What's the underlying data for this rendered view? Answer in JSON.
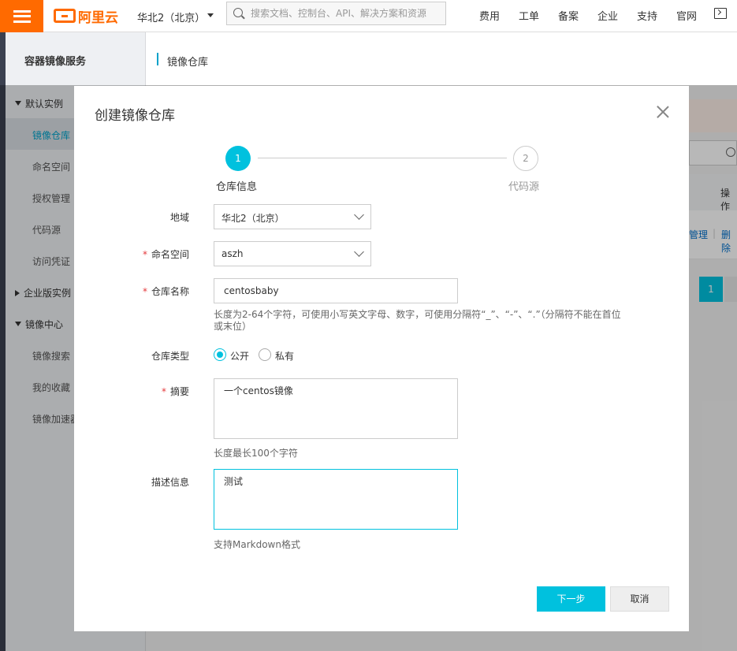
{
  "topbar": {
    "brand": "阿里云",
    "region": "华北2（北京）",
    "search_placeholder": "搜索文档、控制台、API、解决方案和资源",
    "nav": [
      "费用",
      "工单",
      "备案",
      "企业",
      "支持",
      "官网"
    ],
    "brand_color": "#ff6a00"
  },
  "service_title": "容器镜像服务",
  "breadcrumb": "镜像仓库",
  "sidebar": {
    "group_default": "默认实例",
    "items_default": [
      "镜像仓库",
      "命名空间",
      "授权管理",
      "代码源",
      "访问凭证"
    ],
    "group_enterprise": "企业版实例",
    "group_center": "镜像中心",
    "items_center": [
      "镜像搜索",
      "我的收藏",
      "镜像加速器"
    ]
  },
  "background": {
    "ops_header": "操作",
    "link_manage": "管理",
    "link_delete": "删除",
    "divider": "|",
    "page_current": "1"
  },
  "dialog": {
    "title": "创建镜像仓库",
    "steps": [
      {
        "num": "1",
        "label": "仓库信息"
      },
      {
        "num": "2",
        "label": "代码源"
      }
    ],
    "fields": {
      "region_label": "地域",
      "region_value": "华北2（北京）",
      "namespace_label": "命名空间",
      "namespace_value": "aszh",
      "repo_name_label": "仓库名称",
      "repo_name_value": "centosbaby",
      "repo_name_help": "长度为2-64个字符，可使用小写英文字母、数字，可使用分隔符“_”、“-”、“.”（分隔符不能在首位或末位）",
      "repo_type_label": "仓库类型",
      "type_public": "公开",
      "type_private": "私有",
      "summary_label": "摘要",
      "summary_value": "一个centos镜像",
      "summary_help": "长度最长100个字符",
      "desc_label": "描述信息",
      "desc_value": "测试",
      "desc_help": "支持Markdown格式",
      "required_mark": "*"
    },
    "next_button": "下一步",
    "cancel_button": "取消",
    "accent_color": "#00c1de"
  }
}
